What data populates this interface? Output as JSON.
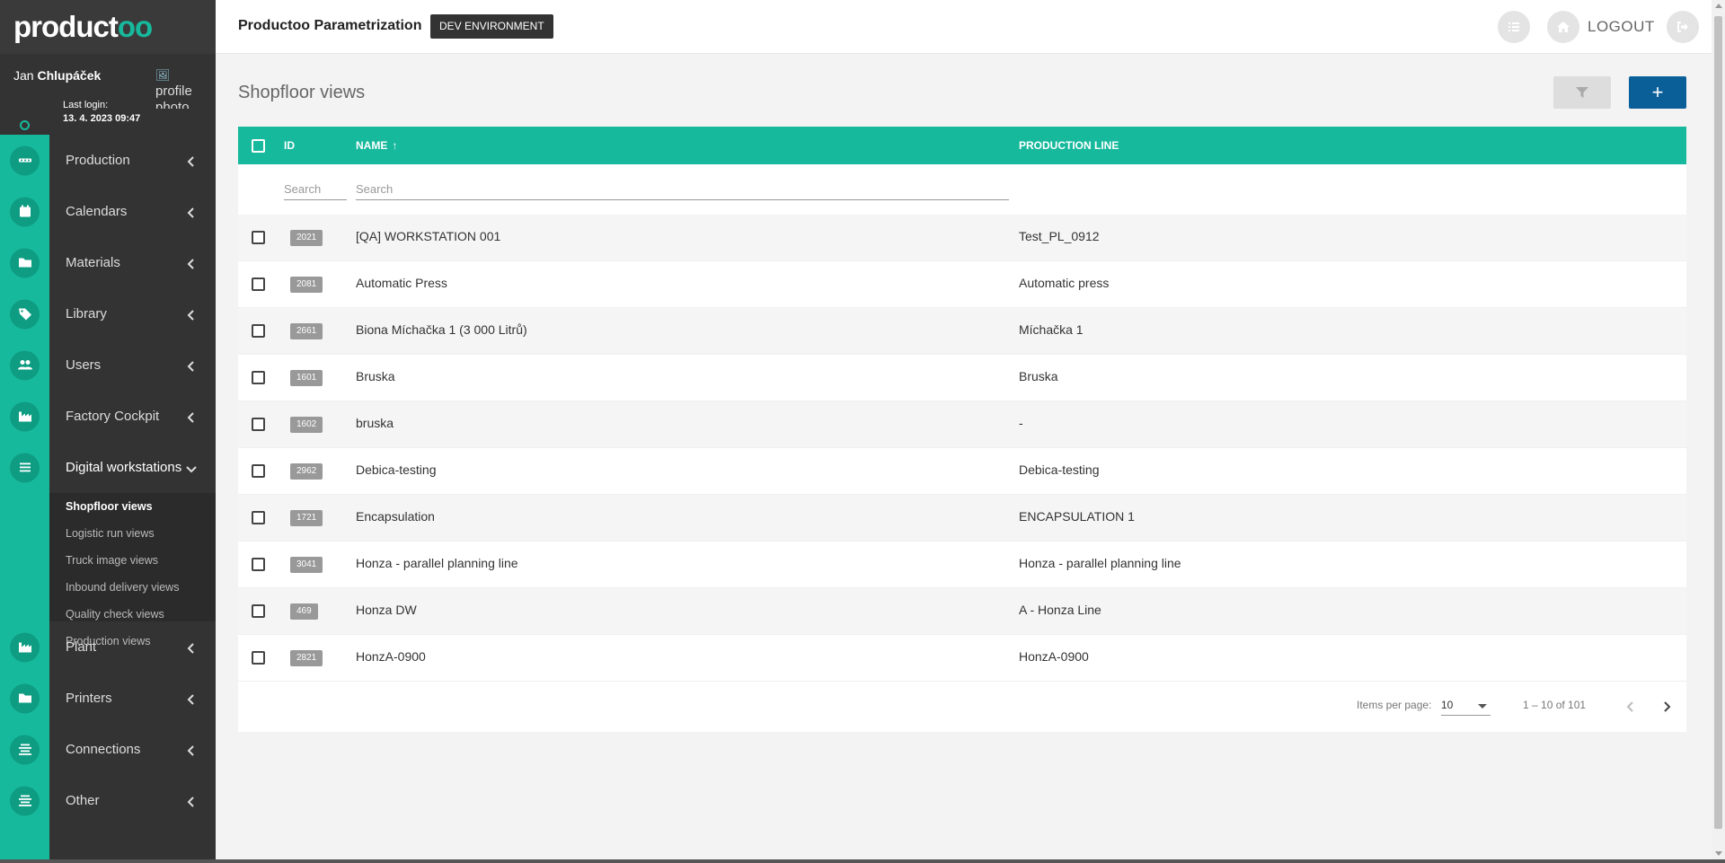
{
  "brand": {
    "logo_main": "product",
    "logo_accent": "oo"
  },
  "user": {
    "first_name": "Jan",
    "last_name": "Chlupáček",
    "last_login_label": "Last login:",
    "last_login_value": "13. 4. 2023 09:47",
    "profile_photo_alt": "profile photo"
  },
  "sidebar": {
    "items_top": [
      {
        "label": "Production",
        "icon": "conveyor-icon"
      },
      {
        "label": "Calendars",
        "icon": "calendar-icon"
      },
      {
        "label": "Materials",
        "icon": "folder-icon"
      },
      {
        "label": "Library",
        "icon": "tags-icon"
      },
      {
        "label": "Users",
        "icon": "users-icon"
      },
      {
        "label": "Factory Cockpit",
        "icon": "factory-icon"
      }
    ],
    "open_item": {
      "label": "Digital workstations",
      "icon": "list-icon",
      "children": [
        {
          "label": "Shopfloor views",
          "active": true
        },
        {
          "label": "Logistic run views"
        },
        {
          "label": "Truck image views"
        },
        {
          "label": "Inbound delivery views"
        },
        {
          "label": "Quality check views"
        },
        {
          "label": "Production views"
        }
      ]
    },
    "items_bottom": [
      {
        "label": "Plant",
        "icon": "factory-icon"
      },
      {
        "label": "Printers",
        "icon": "folder-icon"
      },
      {
        "label": "Connections",
        "icon": "align-icon"
      },
      {
        "label": "Other",
        "icon": "align-icon"
      }
    ]
  },
  "header": {
    "app_title": "Productoo Parametrization",
    "env_badge": "DEV ENVIRONMENT",
    "logout_label": "LOGOUT"
  },
  "page": {
    "title": "Shopfloor views",
    "add_label": "+"
  },
  "table": {
    "columns": {
      "id": "ID",
      "name": "NAME",
      "production_line": "PRODUCTION LINE"
    },
    "sort_indicator": "↑",
    "filters": {
      "id_placeholder": "Search",
      "name_placeholder": "Search"
    },
    "rows": [
      {
        "id": "2021",
        "name": "[QA] WORKSTATION 001",
        "line": "Test_PL_0912"
      },
      {
        "id": "2081",
        "name": "Automatic Press",
        "line": "Automatic press"
      },
      {
        "id": "2661",
        "name": "Biona Míchačka 1 (3 000 Litrů)",
        "line": "Míchačka 1"
      },
      {
        "id": "1601",
        "name": "Bruska",
        "line": "Bruska"
      },
      {
        "id": "1602",
        "name": "bruska",
        "line": "-"
      },
      {
        "id": "2962",
        "name": "Debica-testing",
        "line": "Debica-testing"
      },
      {
        "id": "1721",
        "name": "Encapsulation",
        "line": "ENCAPSULATION 1"
      },
      {
        "id": "3041",
        "name": "Honza - parallel planning line",
        "line": "Honza - parallel planning line"
      },
      {
        "id": "469",
        "name": "Honza DW",
        "line": "A - Honza Line"
      },
      {
        "id": "2821",
        "name": "HonzA-0900",
        "line": "HonzA-0900"
      }
    ]
  },
  "paginator": {
    "items_per_page_label": "Items per page:",
    "items_per_page_value": "10",
    "range_label": "1 – 10 of 101"
  },
  "colors": {
    "accent": "#17b99d",
    "primary": "#0b5f99",
    "sidebar": "#333333"
  }
}
